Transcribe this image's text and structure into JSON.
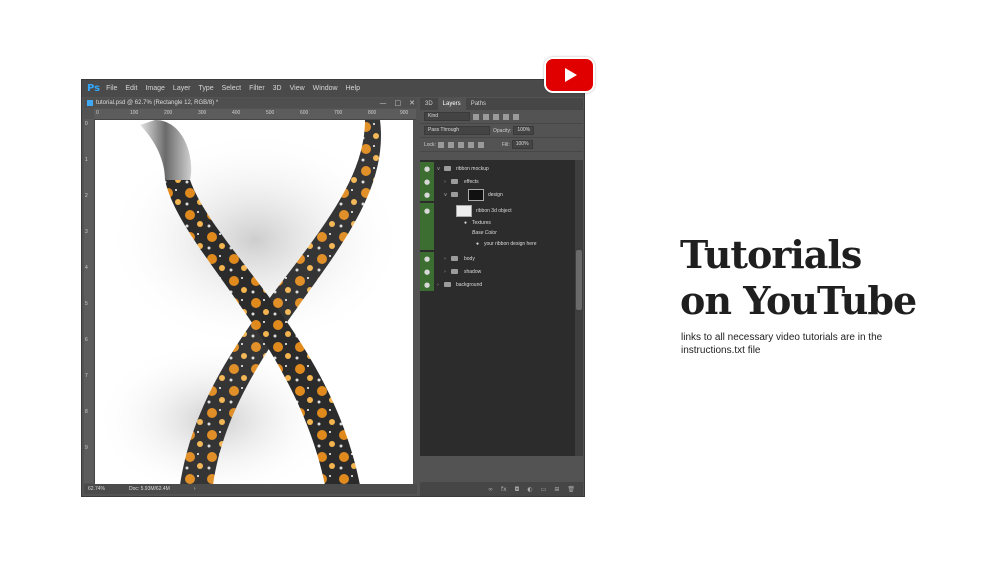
{
  "app": {
    "logo": "Ps",
    "menu": [
      "File",
      "Edit",
      "Image",
      "Layer",
      "Type",
      "Select",
      "Filter",
      "3D",
      "View",
      "Window",
      "Help"
    ]
  },
  "document": {
    "tab_title": "tutorial.psd @ 62.7% (Rectangle 12, RGB/8) *",
    "ruler_top": [
      "0",
      "100",
      "200",
      "300",
      "400",
      "500",
      "600",
      "700",
      "800",
      "900"
    ],
    "ruler_left": [
      "0",
      "1",
      "2",
      "3",
      "4",
      "5",
      "6",
      "7",
      "8",
      "9"
    ]
  },
  "status": {
    "zoom": "62.74%",
    "doc": "Doc: 5.93M/62.4M"
  },
  "panel": {
    "tabs": [
      "3D",
      "Layers",
      "Paths"
    ],
    "filter_kind": "Kind",
    "blend_mode": "Pass Through",
    "opacity_label": "Opacity:",
    "opacity_value": "100%",
    "lock_label": "Lock:",
    "fill_label": "Fill:",
    "fill_value": "100%"
  },
  "layers": [
    {
      "name": "ribbon mockup"
    },
    {
      "name": "effects"
    },
    {
      "name": "design"
    },
    {
      "name": "ribbon 3d object"
    },
    {
      "name": "Textures"
    },
    {
      "name": "Base Color"
    },
    {
      "name": "your ribbon design here"
    },
    {
      "name": "body"
    },
    {
      "name": "shadow"
    },
    {
      "name": "background"
    }
  ],
  "promo": {
    "title_line1": "Tutorials",
    "title_line2": "on YouTube",
    "subtitle": "links to all necessary video tutorials are in the instructions.txt file"
  },
  "colors": {
    "youtube_red": "#e00000",
    "ps_blue": "#31a8ff",
    "layer_visible_green": "#3c6e31"
  }
}
